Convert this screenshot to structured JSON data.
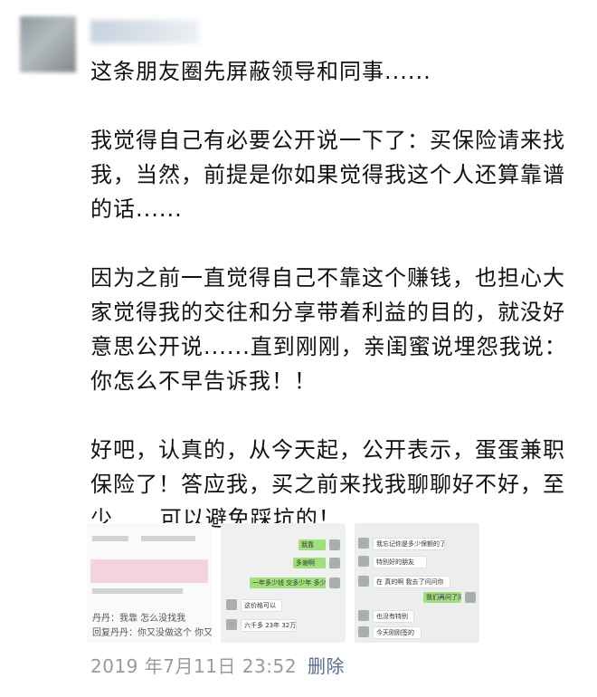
{
  "post": {
    "paragraphs": [
      "这条朋友圈先屏蔽领导和同事......",
      "我觉得自己有必要公开说一下了：买保险请来找我，当然，前提是你如果觉得我这个人还算靠谱的话......",
      "因为之前一直觉得自己不靠这个赚钱，也担心大家觉得我的交往和分享带着利益的目的，就没好意思公开说......直到刚刚，亲闺蜜说埋怨我说：你怎么不早告诉我！！",
      "好吧，认真的，从今天起，公开表示，蛋蛋兼职保险了！答应我，买之前来找我聊聊好不好，至少......可以避免踩坑的！"
    ]
  },
  "photos": {
    "photo1": {
      "lines": [
        "丹丹：我靠 怎么没找我",
        "回复丹丹：你又没做这个 你又没有"
      ]
    },
    "photo2": {
      "bubbles": [
        "我靠",
        "多谢啊",
        "一年多少钱 交多少年 多少保额",
        "这价格可以",
        "六千多 23年 32万"
      ]
    },
    "photo3": {
      "bubbles": [
        "我忘记你是多少保额的了",
        "特别好的朋友",
        "在 真的啊 我去了问问你",
        "我们再问了问",
        "也没有特别",
        "今天刚刚签的"
      ]
    }
  },
  "footer": {
    "timestamp": "2019 年7月11日 23:52",
    "delete_label": "删除"
  },
  "colors": {
    "link": "#5b6a91",
    "meta": "#9a9a9a",
    "wechat_green": "#9fe07a"
  }
}
